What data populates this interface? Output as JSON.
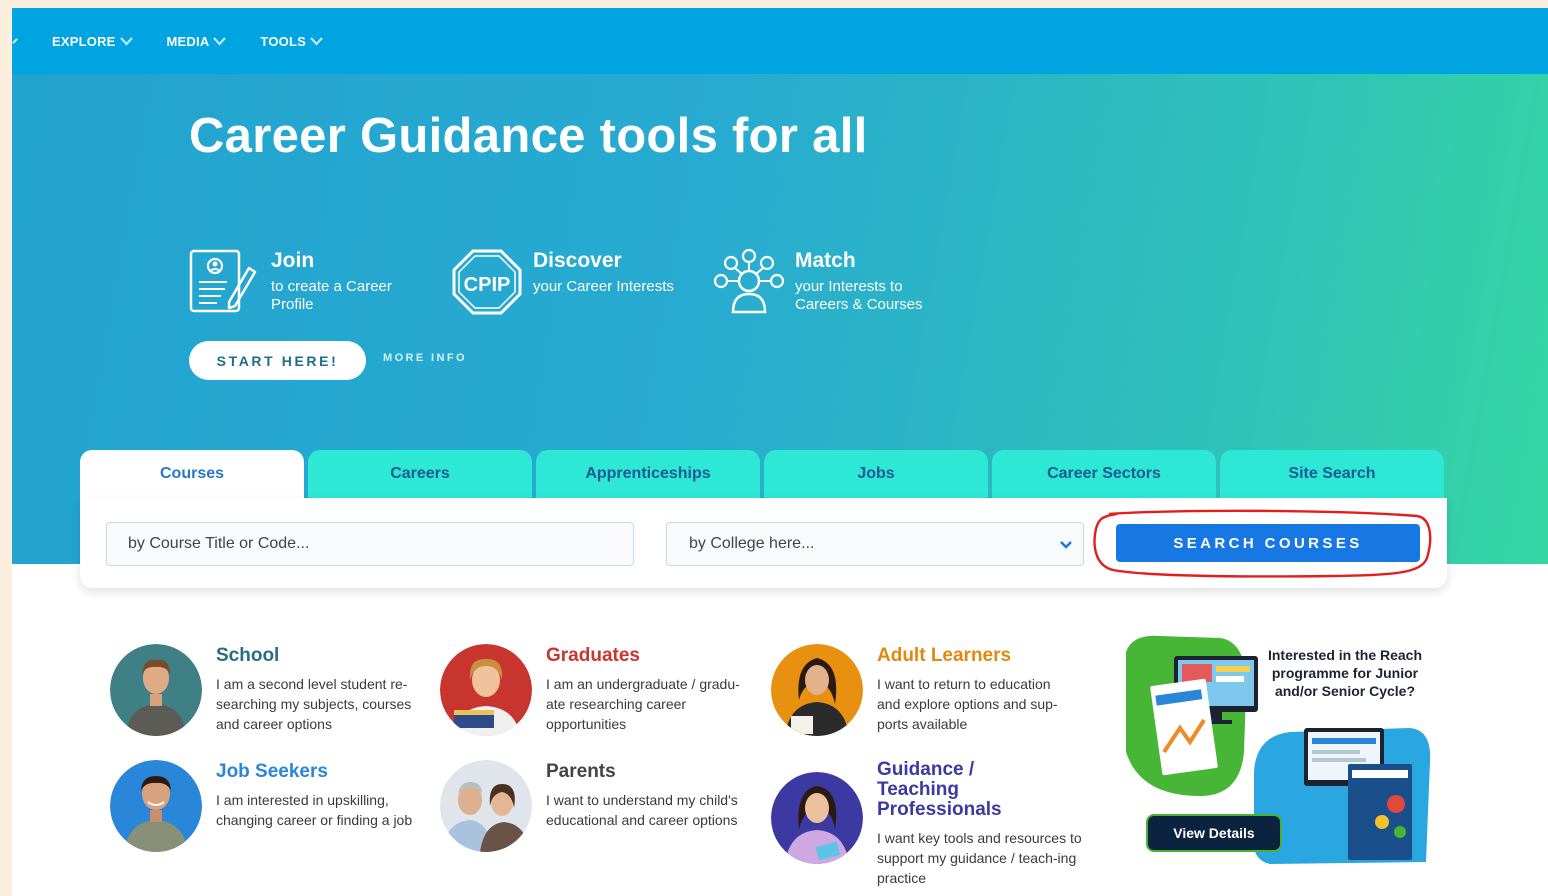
{
  "nav": {
    "items": [
      {
        "label": "EXPLORE"
      },
      {
        "label": "MEDIA"
      },
      {
        "label": "TOOLS"
      }
    ]
  },
  "hero": {
    "title": "Career Guidance tools for all",
    "features": [
      {
        "head": "Join",
        "desc": "to create a Career Profile",
        "icon": "profile-document-icon"
      },
      {
        "head": "Discover",
        "desc": "your Career Interests",
        "icon": "cpip-badge-icon",
        "badge_text": "CPIP"
      },
      {
        "head": "Match",
        "desc": "your Interests to Careers & Courses",
        "icon": "match-network-icon"
      }
    ],
    "start_label": "START HERE!",
    "more_info_label": "MORE INFO"
  },
  "search": {
    "tabs": [
      {
        "label": "Courses",
        "active": true
      },
      {
        "label": "Careers"
      },
      {
        "label": "Apprenticeships"
      },
      {
        "label": "Jobs"
      },
      {
        "label": "Career Sectors"
      },
      {
        "label": "Site Search"
      }
    ],
    "title_value": "by Course Title or Code...",
    "college_value": "by College here...",
    "button_label": "SEARCH COURSES"
  },
  "audiences": [
    {
      "title": "School",
      "desc": "I am a second level student re-searching my subjects, courses and career options",
      "color": "#2b6c80"
    },
    {
      "title": "Graduates",
      "desc": "I am an undergraduate / gradu-ate researching career opportunities",
      "color": "#c8352e"
    },
    {
      "title": "Adult Learners",
      "desc": "I want to return to education and explore options and sup-ports available",
      "color": "#e08a0b"
    },
    {
      "title": "Job Seekers",
      "desc": "I am interested in upskilling, changing career or finding a job",
      "color": "#2a86d8"
    },
    {
      "title": "Parents",
      "desc": "I want to understand my child's educational and career options",
      "color": "#444444"
    },
    {
      "title": "Guidance / Teaching Professionals",
      "desc": "I want key tools and resources to support my guidance / teach-ing practice",
      "color": "#3c3aa2"
    }
  ],
  "promo": {
    "text": "Interested in the Reach programme for Junior and/or Senior Cycle?",
    "button_label": "View Details"
  },
  "colors": {
    "nav": "#00a4e0",
    "tab": "#2ee8d6",
    "search_button": "#1778e3",
    "promo_button": "#0c2340"
  }
}
